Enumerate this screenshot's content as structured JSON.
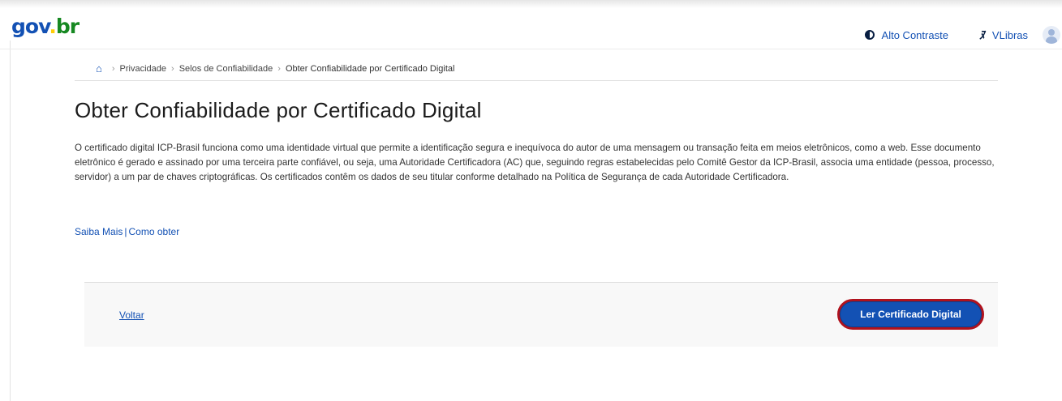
{
  "header": {
    "logo": {
      "part1": "gov",
      "dot": ".",
      "part2": "br"
    },
    "contrast_label": "Alto Contraste",
    "libras_label": "VLibras"
  },
  "breadcrumb": {
    "items": [
      "Privacidade",
      "Selos de Confiabilidade",
      "Obter Confiabilidade por Certificado Digital"
    ]
  },
  "main": {
    "title": "Obter Confiabilidade por Certificado Digital",
    "description": "O certificado digital ICP-Brasil funciona como uma identidade virtual que permite a identificação segura e inequívoca do autor de uma mensagem ou transação feita em meios eletrônicos, como a web. Esse documento eletrônico é gerado e assinado por uma terceira parte confiável, ou seja, uma Autoridade Certificadora (AC) que, seguindo regras estabelecidas pelo Comitê Gestor da ICP-Brasil, associa uma entidade (pessoa, processo, servidor) a um par de chaves criptográficas. Os certificados contêm os dados de seu titular conforme detalhado na Política de Segurança de cada Autoridade Certificadora.",
    "links": {
      "saiba_mais": "Saiba Mais",
      "separator": "|",
      "como_obter": "Como obter"
    }
  },
  "footer": {
    "back_label": "Voltar",
    "read_certificate_label": "Ler Certificado Digital"
  },
  "colors": {
    "primary_blue": "#1351b4",
    "highlight_red": "#b0121d",
    "logo_green": "#168821",
    "logo_yellow": "#ffcd07"
  },
  "icons": {
    "home": "home-icon",
    "contrast": "contrast-icon",
    "libras": "libras-hands-icon",
    "user": "user-avatar-icon"
  }
}
